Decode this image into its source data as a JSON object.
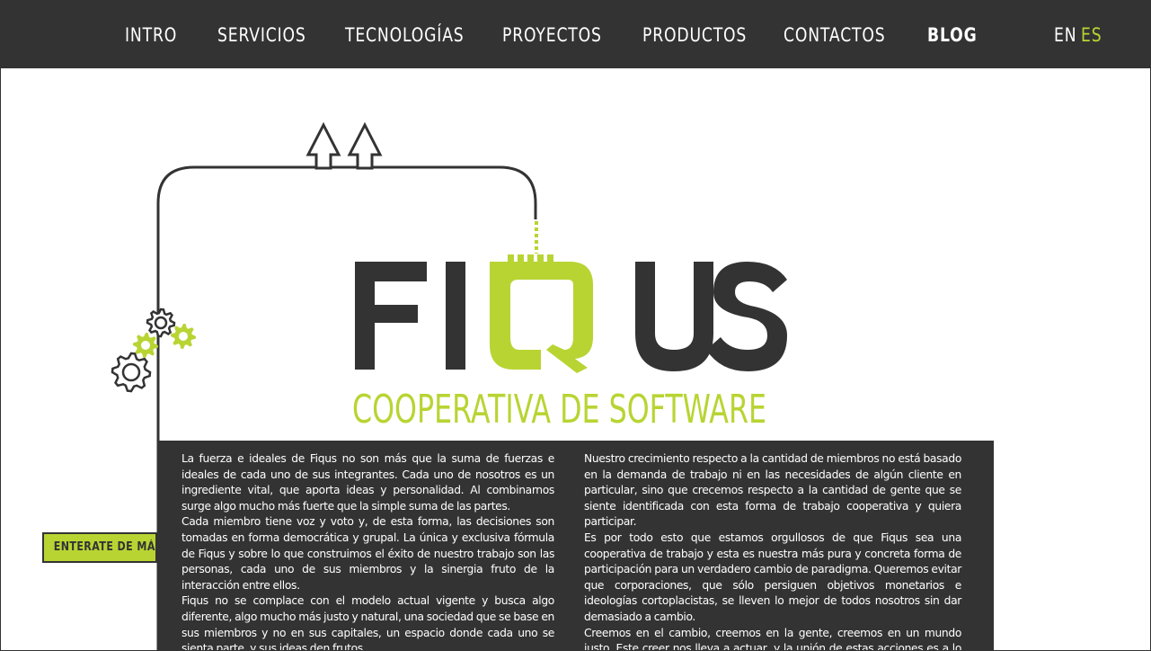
{
  "colors": {
    "dark": "#333333",
    "accent": "#b8d433",
    "light": "#ffffff"
  },
  "nav": {
    "items": [
      {
        "label": "INTRO"
      },
      {
        "label": "SERVICIOS"
      },
      {
        "label": "TECNOLOGÍAS"
      },
      {
        "label": "PROYECTOS"
      },
      {
        "label": "PRODUCTOS"
      },
      {
        "label": "CONTACTOS"
      },
      {
        "label": "BLOG",
        "active": true
      }
    ],
    "lang": {
      "en": "EN",
      "es": "ES",
      "selected": "ES"
    }
  },
  "hero": {
    "logo": {
      "part1": "FI",
      "part2": "US",
      "q_icon": "q-circuit-icon"
    },
    "tagline": "COOPERATIVA DE SOFTWARE",
    "icons": [
      "arrow-up-icon",
      "gear-icon"
    ]
  },
  "cta": {
    "label": "ENTERATE DE MÁS"
  },
  "content": {
    "left": [
      "La fuerza e ideales de Fiqus no son más que la suma de fuerzas e ideales de cada uno de sus integrantes. Cada uno de nosotros es un ingrediente vital, que aporta ideas y personalidad. Al combinarnos surge algo mucho más fuerte que la simple suma de las partes.",
      "Cada miembro tiene voz y voto y, de esta forma, las decisiones son tomadas en forma democrática y grupal. La única y exclusiva fórmula de Fiqus y sobre lo que construimos el éxito de nuestro trabajo son las personas, cada uno de sus miembros y la sinergia fruto de la interacción entre ellos.",
      "Fiqus no se complace con el modelo actual vigente y busca algo diferente, algo mucho más justo y natural, una sociedad que se base en sus miembros y no en sus capitales, un espacio donde cada uno se sienta parte, y sus ideas den frutos."
    ],
    "right": [
      "Nuestro crecimiento respecto a la cantidad de miembros no está basado en la demanda de trabajo ni en las necesidades de algún cliente en particular, sino que crecemos respecto a la cantidad de gente que se siente identificada con esta forma de trabajo cooperativa y quiera participar.",
      "Es por todo esto que estamos orgullosos de que Fiqus sea una cooperativa de trabajo y esta es nuestra más pura y concreta forma de participación para un verdadero cambio de paradigma. Queremos evitar que corporaciones, que sólo persiguen objetivos monetarios e ideologías cortoplacistas, se lleven lo mejor de todos nosotros sin dar demasiado a cambio.",
      "Creemos en el cambio, creemos en la gente, creemos en un mundo justo. Este creer nos lleva a actuar, y la unión de estas acciones es a lo que llamamos Fiqus."
    ]
  }
}
